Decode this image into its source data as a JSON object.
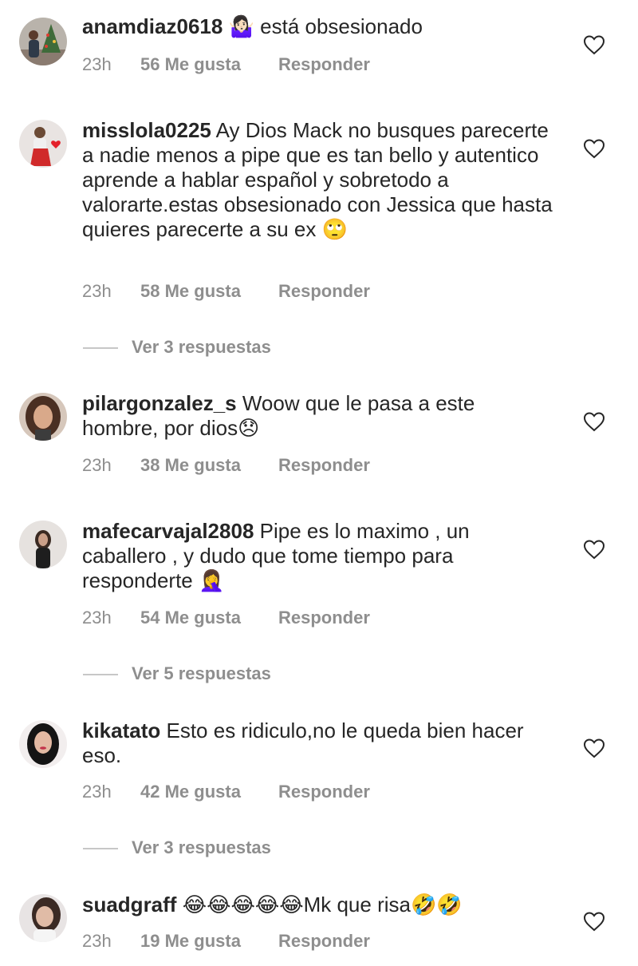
{
  "comments": [
    {
      "username": "anamdiaz0618",
      "text": " 🤷🏻‍♀️ está obsesionado",
      "time": "23h",
      "likes": "56 Me gusta",
      "reply_label": "Responder",
      "avatar_icon": "avatar-photo-christmas-tree"
    },
    {
      "username": "misslola0225",
      "text": " Ay Dios Mack no busques parecerte a nadie menos a pipe que es tan bello y autentico aprende a hablar español y sobretodo a valorarte.estas obsesionado con Jessica que hasta quieres parecerte a su ex 🙄",
      "time": "23h",
      "likes": "58 Me gusta",
      "reply_label": "Responder",
      "view_replies": "Ver 3 respuestas",
      "avatar_icon": "avatar-photo-red-heart"
    },
    {
      "username": "pilargonzalez_s",
      "text": " Woow que le pasa a este hombre, por dios😞",
      "time": "23h",
      "likes": "38 Me gusta",
      "reply_label": "Responder",
      "avatar_icon": "avatar-photo-woman"
    },
    {
      "username": "mafecarvajal2808",
      "text": " Pipe es lo maximo , un caballero , y dudo que tome tiempo para responderte 🤦‍♀️",
      "time": "23h",
      "likes": "54 Me gusta",
      "reply_label": "Responder",
      "view_replies": "Ver 5 respuestas",
      "avatar_icon": "avatar-photo-woman"
    },
    {
      "username": "kikatato",
      "text": " Esto es ridiculo,no le queda bien hacer eso.",
      "time": "23h",
      "likes": "42 Me gusta",
      "reply_label": "Responder",
      "view_replies": "Ver 3 respuestas",
      "avatar_icon": "avatar-photo-woman"
    },
    {
      "username": "suadgraff",
      "text": " 😂😂😂😂😂Mk que risa🤣🤣",
      "time": "23h",
      "likes": "19 Me gusta",
      "reply_label": "Responder",
      "avatar_icon": "avatar-photo-woman"
    }
  ],
  "icons": {
    "like": "heart-outline-icon"
  },
  "colors": {
    "text": "#262626",
    "secondary": "#8e8e8e",
    "divider": "#c7c7c7",
    "background": "#ffffff"
  }
}
